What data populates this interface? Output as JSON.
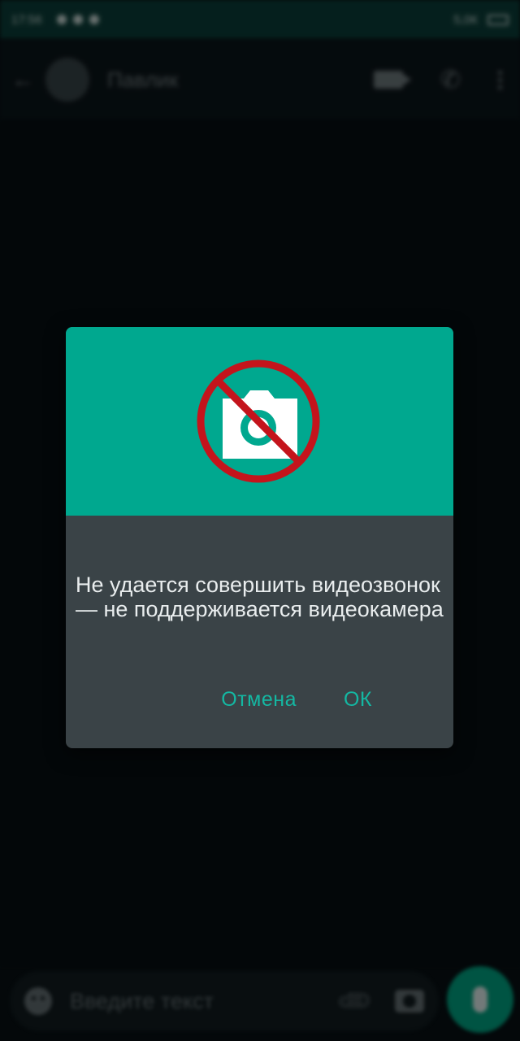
{
  "status_bar": {
    "time": "17:56",
    "right_text": "5,0К"
  },
  "app_bar": {
    "contact_name": "Павлик"
  },
  "input_bar": {
    "placeholder": "Введите текст"
  },
  "dialog": {
    "message": "Не удается совершить видеозвонок — не поддерживается видеокамера",
    "cancel_label": "Отмена",
    "ok_label": "ОК"
  },
  "colors": {
    "accent": "#00a88f",
    "dialog_bg": "#3a4347",
    "button_text": "#14b7a2",
    "prohibited_red": "#c4141c"
  }
}
